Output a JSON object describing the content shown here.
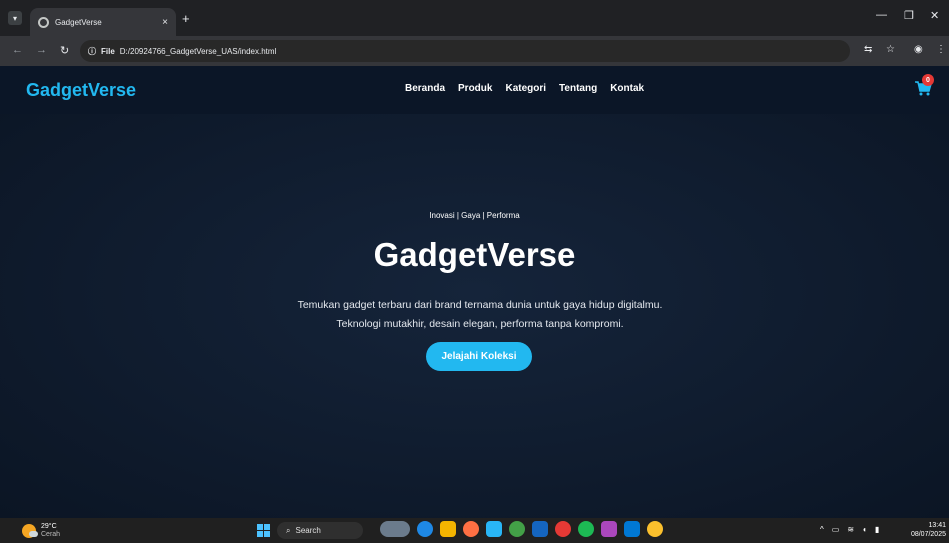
{
  "browser": {
    "tab_title": "GadgetVerse",
    "tab_close": "×",
    "new_tab": "+",
    "file_label": "File",
    "url": "D:/20924766_GadgetVerse_UAS/index.html"
  },
  "site": {
    "brand": "GadgetVerse",
    "menu": [
      "Beranda",
      "Produk",
      "Kategori",
      "Tentang",
      "Kontak"
    ],
    "cart_count": "0"
  },
  "hero": {
    "tagline": "Inovasi | Gaya | Performa",
    "title": "GadgetVerse",
    "description": "Temukan gadget terbaru dari brand ternama dunia untuk gaya hidup digitalmu. Teknologi mutakhir, desain elegan, performa tanpa kompromi.",
    "cta": "Jelajahi Koleksi"
  },
  "taskbar": {
    "weather_temp": "29°C",
    "weather_desc": "Cerah",
    "search": "Search",
    "time": "13:41",
    "date": "08/07/2025"
  },
  "colors": {
    "accent": "#22b8f0",
    "nav_bg": "#0b1627",
    "hero_bg": "#0f1b2d",
    "badge": "#e53935"
  }
}
